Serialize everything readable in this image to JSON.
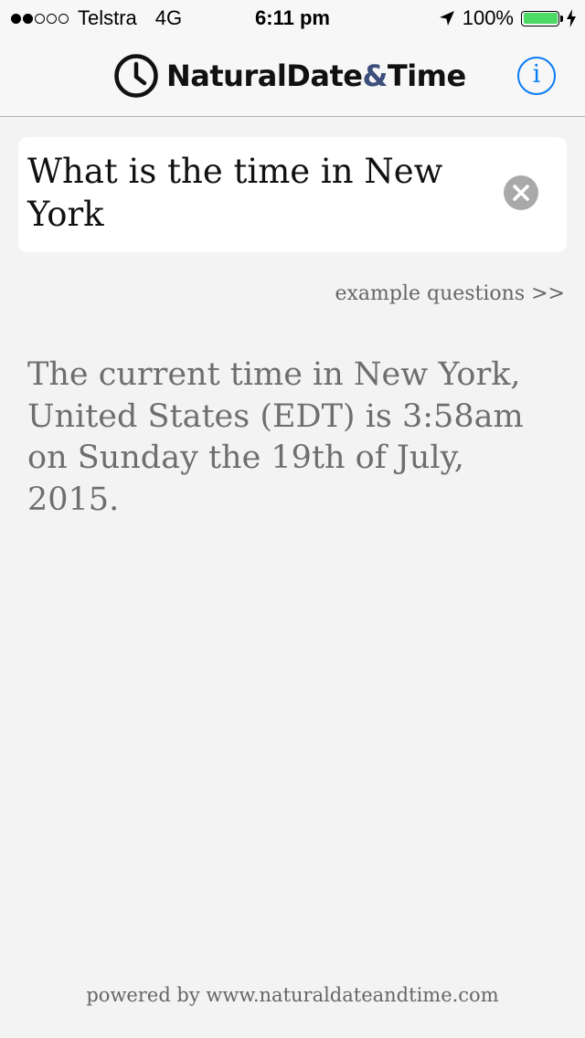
{
  "status_bar": {
    "carrier": "Telstra",
    "network": "4G",
    "time": "6:11 pm",
    "battery": "100%",
    "battery_level": 1.0,
    "signal_strength": 2,
    "signal_max": 5,
    "icons": [
      "location-arrow-icon",
      "charging-bolt-icon"
    ]
  },
  "nav": {
    "app_name_part1": "NaturalDate",
    "app_name_amp": "&",
    "app_name_part2": "Time",
    "info_glyph": "i"
  },
  "query": {
    "value": "What is the time in New York"
  },
  "example_link": "example questions >>",
  "answer": "The current time in New York, United States (EDT) is 3:58am on Sunday the 19th of July, 2015.",
  "footer": "powered by www.naturaldateandtime.com",
  "colors": {
    "accent": "#0a7bf5",
    "battery": "#4cd964",
    "answer_text": "#6e6e6e",
    "background": "#f3f3f3"
  }
}
